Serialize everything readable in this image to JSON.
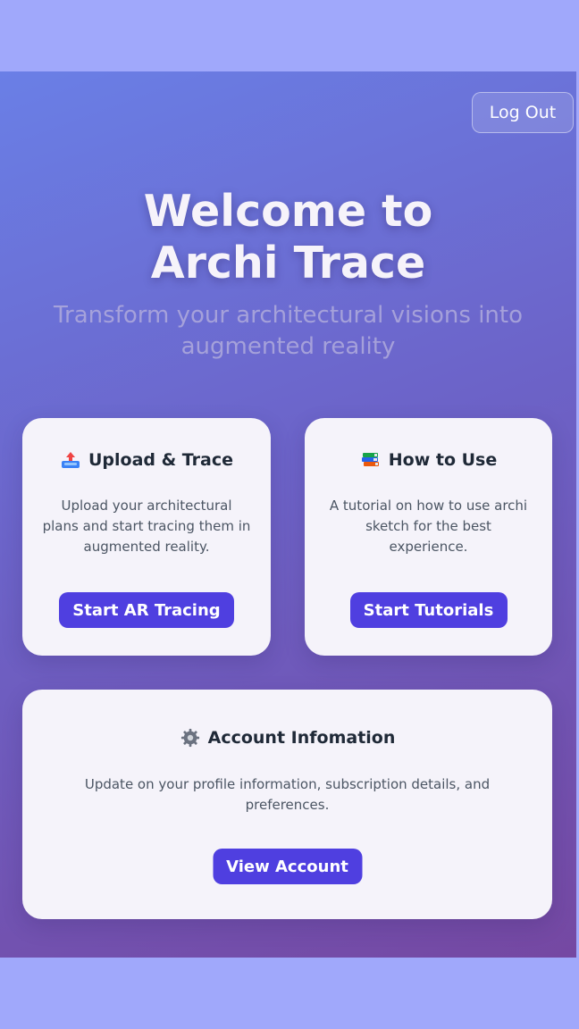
{
  "header": {
    "logout_label": "Log Out"
  },
  "hero": {
    "title_line1": "Welcome to",
    "title_line2": "Archi Trace",
    "subtitle": "Transform your architectural visions into augmented reality"
  },
  "cards": {
    "upload": {
      "icon": "upload-tray-icon",
      "title": "Upload & Trace",
      "description": "Upload your architectural plans and start tracing them in augmented reality.",
      "button_label": "Start AR Tracing"
    },
    "howto": {
      "icon": "books-icon",
      "title": "How to Use",
      "description": "A tutorial on how to use archi sketch for the best experience.",
      "button_label": "Start Tutorials"
    },
    "account": {
      "icon": "gear-icon",
      "title": "Account Infomation",
      "description": "Update on your profile information, subscription details, and preferences.",
      "button_label": "View Account"
    }
  },
  "colors": {
    "gradient_start": "#6a7fe6",
    "gradient_end": "#7548a2",
    "button": "#4f3fe0",
    "card": "#f5f3fa",
    "page_background": "#a0a8fb"
  }
}
